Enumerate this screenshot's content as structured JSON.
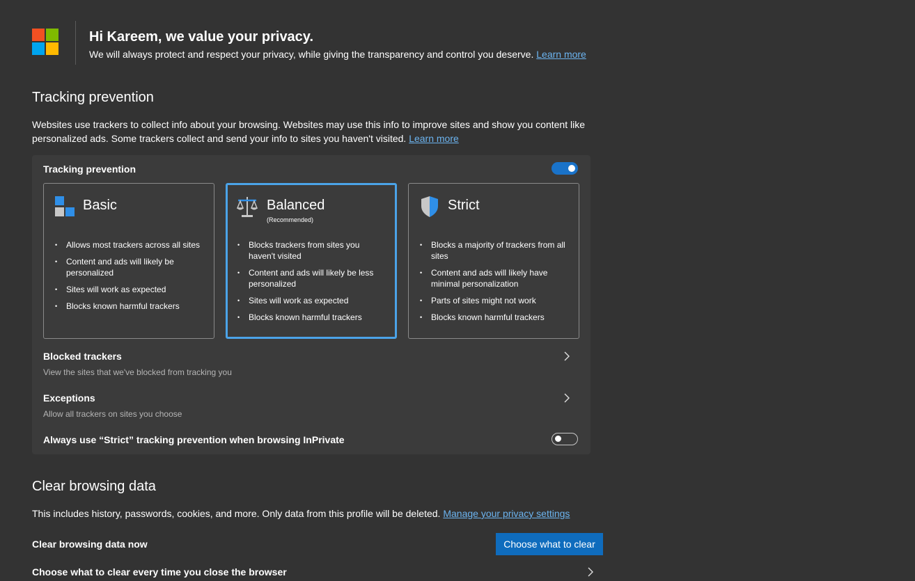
{
  "colors": {
    "background": "#333333",
    "card": "#3b3b3b",
    "accent": "#1a73c9",
    "link": "#6cb4f0",
    "logo": [
      "#f25022",
      "#7fba00",
      "#00a4ef",
      "#ffb900"
    ]
  },
  "header": {
    "greeting": "Hi Kareem, we value your privacy.",
    "subtitle": "We will always protect and respect your privacy, while giving the transparency and control you deserve.",
    "learn_more": "Learn more"
  },
  "tracking": {
    "section_title": "Tracking prevention",
    "description": "Websites use trackers to collect info about your browsing. Websites may use this info to improve sites and show you content like personalized ads. Some trackers collect and send your info to sites you haven't visited.",
    "learn_more": "Learn more",
    "card_title": "Tracking prevention",
    "toggle_on": true,
    "options": [
      {
        "title": "Basic",
        "subtitle": "",
        "icon": "basic-blocks-icon",
        "bullets": [
          "Allows most trackers across all sites",
          "Content and ads will likely be personalized",
          "Sites will work as expected",
          "Blocks known harmful trackers"
        ]
      },
      {
        "title": "Balanced",
        "subtitle": "(Recommended)",
        "icon": "balance-scale-icon",
        "bullets": [
          "Blocks trackers from sites you haven't visited",
          "Content and ads will likely be less personalized",
          "Sites will work as expected",
          "Blocks known harmful trackers"
        ]
      },
      {
        "title": "Strict",
        "subtitle": "",
        "icon": "shield-icon",
        "bullets": [
          "Blocks a majority of trackers from all sites",
          "Content and ads will likely have minimal personalization",
          "Parts of sites might not work",
          "Blocks known harmful trackers"
        ]
      }
    ],
    "selected_option": "Balanced",
    "blocked_trackers": {
      "title": "Blocked trackers",
      "subtitle": "View the sites that we've blocked from tracking you"
    },
    "exceptions": {
      "title": "Exceptions",
      "subtitle": "Allow all trackers on sites you choose"
    },
    "inprivate": {
      "label": "Always use “Strict” tracking prevention when browsing InPrivate",
      "toggle_on": false
    }
  },
  "clear": {
    "section_title": "Clear browsing data",
    "description": "This includes history, passwords, cookies, and more. Only data from this profile will be deleted.",
    "manage_link": "Manage your privacy settings",
    "now_label": "Clear browsing data now",
    "button_label": "Choose what to clear",
    "on_close_label": "Choose what to clear every time you close the browser"
  }
}
